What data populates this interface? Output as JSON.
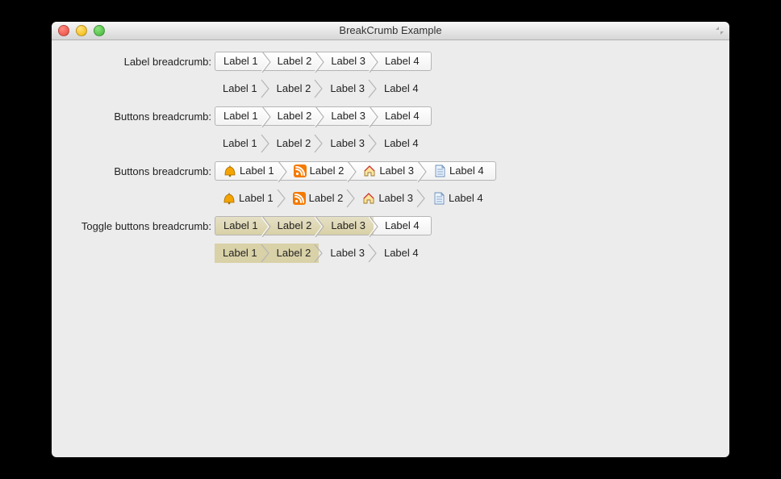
{
  "window": {
    "title": "BreakCrumb Example"
  },
  "rows": [
    {
      "label": "Label breadcrumb:",
      "style": "bordered",
      "icons": false,
      "toggle": false
    },
    {
      "label": "",
      "style": "flat",
      "icons": false,
      "toggle": false
    },
    {
      "label": "Buttons breadcrumb:",
      "style": "bordered",
      "icons": false,
      "toggle": false
    },
    {
      "label": "",
      "style": "flat",
      "icons": false,
      "toggle": false
    },
    {
      "label": "Buttons breadcrumb:",
      "style": "bordered",
      "icons": true,
      "toggle": false
    },
    {
      "label": "",
      "style": "flat",
      "icons": true,
      "toggle": false
    },
    {
      "label": "Toggle buttons breadcrumb:",
      "style": "bordered",
      "icons": false,
      "toggle": true,
      "selected": [
        0,
        1,
        2
      ]
    },
    {
      "label": "",
      "style": "flat",
      "icons": false,
      "toggle": true,
      "selected": [
        0,
        1
      ]
    }
  ],
  "items": [
    {
      "label": "Label 1",
      "icon": "bell-icon"
    },
    {
      "label": "Label 2",
      "icon": "rss-icon"
    },
    {
      "label": "Label 3",
      "icon": "home-icon"
    },
    {
      "label": "Label 4",
      "icon": "page-icon"
    }
  ]
}
